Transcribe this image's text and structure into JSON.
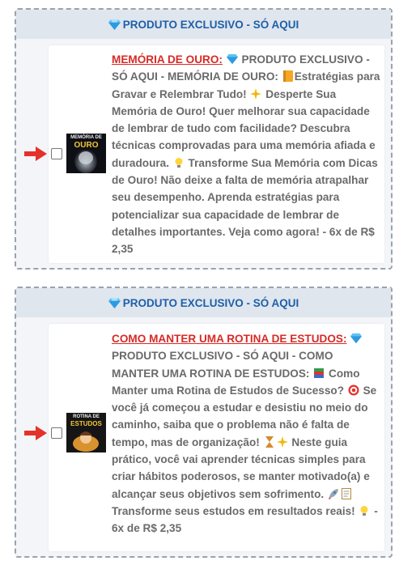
{
  "colors": {
    "accent_blue": "#1f5fa8",
    "title_red": "#d62b27",
    "body_gray": "#6a6a6a",
    "arrow_red": "#e5312b"
  },
  "offers": [
    {
      "badge": "PRODUTO EXCLUSIVO - SÓ AQUI",
      "thumb_line1": "MEMÓRIA DE",
      "thumb_line2": "OURO",
      "title": "MEMÓRIA DE OURO:",
      "seg1": " PRODUTO EXCLUSIVO - SÓ AQUI - MEMÓRIA DE OURO: ",
      "seg2": "Estratégias para Gravar e Relembrar Tudo! ",
      "seg3": " Desperte Sua Memória de Ouro! Quer melhorar sua capacidade de lembrar de tudo com facilidade? Descubra técnicas comprovadas para uma memória afiada e duradoura. ",
      "seg4": " Transforme Sua Memória com Dicas de Ouro! Não deixe a falta de memória atrapalhar seu desempenho. Aprenda estratégias para potencializar sua capacidade de lembrar de detalhes importantes. Veja como agora! - 6x de R$ 2,35",
      "checked": false
    },
    {
      "badge": "PRODUTO EXCLUSIVO - SÓ AQUI",
      "thumb_line1": "ROTINA DE",
      "thumb_line2": "ESTUDOS",
      "title": "COMO MANTER UMA ROTINA DE ESTUDOS:",
      "seg1": " PRODUTO EXCLUSIVO - SÓ AQUI - COMO MANTER UMA ROTINA DE ESTUDOS: ",
      "seg2": " Como Manter uma Rotina de Estudos de Sucesso? ",
      "seg3": " Se você já começou a estudar e desistiu no meio do caminho, saiba que o problema não é falta de tempo, mas de organização! ",
      "seg4": " Neste guia prático, você vai aprender técnicas simples para criar hábitos poderosos, se manter motivado(a) e alcançar seus objetivos sem sofrimento. ",
      "seg5": " Transforme seus estudos em resultados reais! ",
      "seg6": " - 6x de R$ 2,35",
      "checked": false
    }
  ]
}
